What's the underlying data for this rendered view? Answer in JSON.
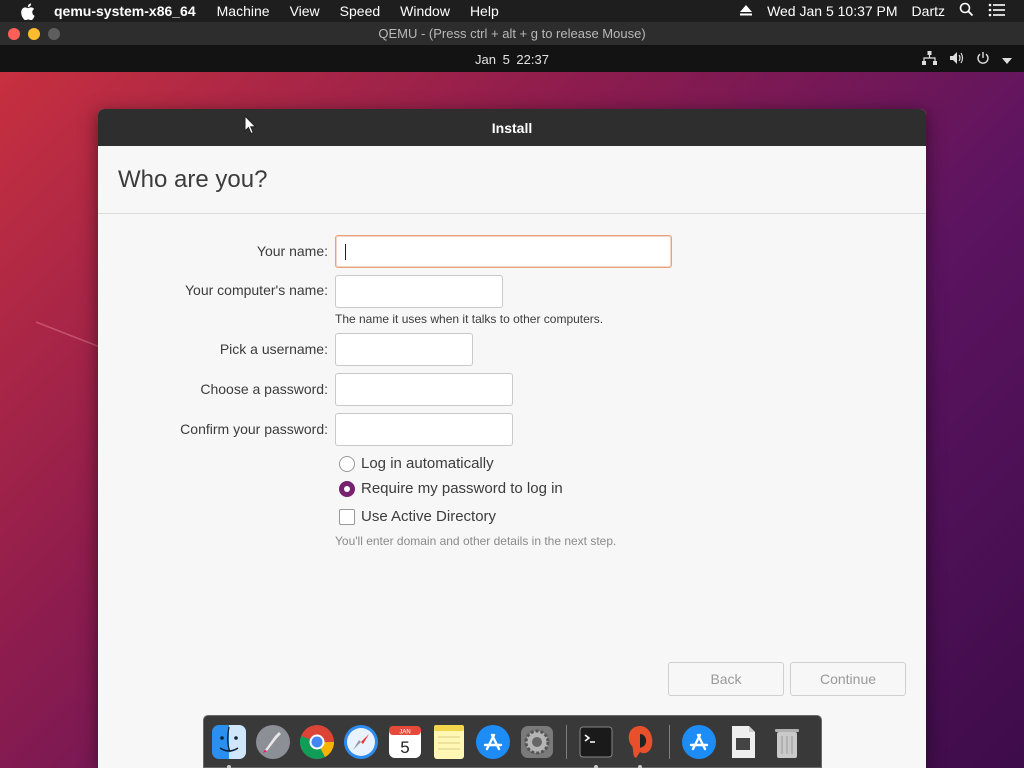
{
  "mac_menubar": {
    "app_name": "qemu-system-x86_64",
    "menus": [
      "Machine",
      "View",
      "Speed",
      "Window",
      "Help"
    ],
    "datetime": "Wed Jan 5  10:37 PM",
    "user": "Dartz"
  },
  "qemu_window": {
    "title": "QEMU - (Press ctrl + alt + g to release Mouse)"
  },
  "ubuntu_topbar": {
    "clock": "Jan 5  22:37"
  },
  "installer": {
    "window_title": "Install",
    "page_title": "Who are you?",
    "fields": {
      "name_label": "Your name:",
      "name_value": "",
      "computer_label": "Your computer's name:",
      "computer_value": "",
      "computer_hint": "The name it uses when it talks to other computers.",
      "username_label": "Pick a username:",
      "username_value": "",
      "password_label": "Choose a password:",
      "password_value": "",
      "confirm_label": "Confirm your password:",
      "confirm_value": ""
    },
    "login_options": {
      "auto_label": "Log in automatically",
      "auto_selected": false,
      "require_label": "Require my password to log in",
      "require_selected": true
    },
    "active_directory": {
      "label": "Use Active Directory",
      "checked": false,
      "hint": "You'll enter domain and other details in the next step."
    },
    "buttons": {
      "back": "Back",
      "continue": "Continue"
    }
  },
  "dock": {
    "apps": [
      "Finder",
      "Launchpad",
      "Chrome",
      "Safari",
      "Calendar",
      "Notes",
      "App Store",
      "System Preferences",
      "Terminal",
      "Ubuntu installer",
      "App Store folder",
      "Document",
      "Trash"
    ],
    "calendar_month": "JAN",
    "calendar_day": "5"
  },
  "colors": {
    "accent": "#77216f",
    "focus_border": "#e9a27e",
    "header_dark": "#2e2e2e"
  }
}
